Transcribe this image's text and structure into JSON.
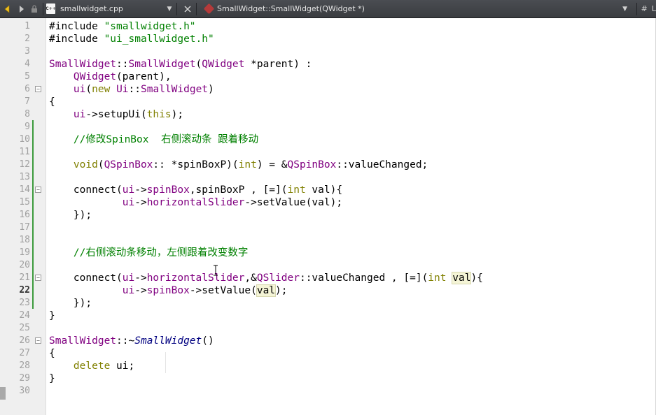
{
  "toolbar": {
    "file_name": "smallwidget.cpp",
    "file_icon_text": "C++",
    "function": "SmallWidget::SmallWidget(QWidget *)",
    "right_label": "L",
    "right_hash": "#"
  },
  "editor": {
    "current_line": 22,
    "lines": [
      {
        "n": "1",
        "tokens": [
          {
            "t": "#include ",
            "c": "p"
          },
          {
            "t": "\"smallwidget.h\"",
            "c": "s"
          }
        ]
      },
      {
        "n": "2",
        "tokens": [
          {
            "t": "#include ",
            "c": "p"
          },
          {
            "t": "\"ui_smallwidget.h\"",
            "c": "s"
          }
        ]
      },
      {
        "n": "3",
        "tokens": []
      },
      {
        "n": "4",
        "tokens": [
          {
            "t": "SmallWidget",
            "c": "t"
          },
          {
            "t": "::",
            "c": "o"
          },
          {
            "t": "SmallWidget",
            "c": "t"
          },
          {
            "t": "(",
            "c": "o"
          },
          {
            "t": "QWidget",
            "c": "t"
          },
          {
            "t": " *parent) :",
            "c": "o"
          }
        ]
      },
      {
        "n": "5",
        "tokens": [
          {
            "t": "    ",
            "c": "o"
          },
          {
            "t": "QWidget",
            "c": "t"
          },
          {
            "t": "(parent),",
            "c": "o"
          }
        ]
      },
      {
        "n": "6",
        "fold": true,
        "tokens": [
          {
            "t": "    ",
            "c": "o"
          },
          {
            "t": "ui",
            "c": "t"
          },
          {
            "t": "(",
            "c": "o"
          },
          {
            "t": "new",
            "c": "k"
          },
          {
            "t": " ",
            "c": "o"
          },
          {
            "t": "Ui",
            "c": "t"
          },
          {
            "t": "::",
            "c": "o"
          },
          {
            "t": "SmallWidget",
            "c": "t"
          },
          {
            "t": ")",
            "c": "o"
          }
        ]
      },
      {
        "n": "7",
        "tokens": [
          {
            "t": "{",
            "c": "o"
          }
        ]
      },
      {
        "n": "8",
        "tokens": [
          {
            "t": "    ",
            "c": "o"
          },
          {
            "t": "ui",
            "c": "t"
          },
          {
            "t": "->",
            "c": "o"
          },
          {
            "t": "setupUi",
            "c": "o"
          },
          {
            "t": "(",
            "c": "o"
          },
          {
            "t": "this",
            "c": "k"
          },
          {
            "t": ");",
            "c": "o"
          }
        ]
      },
      {
        "n": "9",
        "tokens": []
      },
      {
        "n": "10",
        "tokens": [
          {
            "t": "    ",
            "c": "o"
          },
          {
            "t": "//修改SpinBox  右侧滚动条 跟着移动",
            "c": "c"
          }
        ]
      },
      {
        "n": "11",
        "tokens": []
      },
      {
        "n": "12",
        "tokens": [
          {
            "t": "    ",
            "c": "o"
          },
          {
            "t": "void",
            "c": "k"
          },
          {
            "t": "(",
            "c": "o"
          },
          {
            "t": "QSpinBox",
            "c": "t"
          },
          {
            "t": ":: *spinBoxP)(",
            "c": "o"
          },
          {
            "t": "int",
            "c": "k"
          },
          {
            "t": ") = &",
            "c": "o"
          },
          {
            "t": "QSpinBox",
            "c": "t"
          },
          {
            "t": "::valueChanged;",
            "c": "o"
          }
        ]
      },
      {
        "n": "13",
        "tokens": []
      },
      {
        "n": "14",
        "fold": true,
        "tokens": [
          {
            "t": "    connect(",
            "c": "o"
          },
          {
            "t": "ui",
            "c": "t"
          },
          {
            "t": "->",
            "c": "o"
          },
          {
            "t": "spinBox",
            "c": "t"
          },
          {
            "t": ",spinBoxP , [=](",
            "c": "o"
          },
          {
            "t": "int",
            "c": "k"
          },
          {
            "t": " val){",
            "c": "o"
          }
        ]
      },
      {
        "n": "15",
        "tokens": [
          {
            "t": "            ",
            "c": "o"
          },
          {
            "t": "ui",
            "c": "t"
          },
          {
            "t": "->",
            "c": "o"
          },
          {
            "t": "horizontalSlider",
            "c": "t"
          },
          {
            "t": "->setValue(val);",
            "c": "o"
          }
        ]
      },
      {
        "n": "16",
        "tokens": [
          {
            "t": "    });",
            "c": "o"
          }
        ]
      },
      {
        "n": "17",
        "tokens": []
      },
      {
        "n": "18",
        "tokens": []
      },
      {
        "n": "19",
        "tokens": [
          {
            "t": "    ",
            "c": "o"
          },
          {
            "t": "//右侧滚动条移动，左侧跟着改变数字",
            "c": "c"
          }
        ]
      },
      {
        "n": "20",
        "tokens": []
      },
      {
        "n": "21",
        "fold": true,
        "tokens": [
          {
            "t": "    connect(",
            "c": "o"
          },
          {
            "t": "ui",
            "c": "t"
          },
          {
            "t": "->",
            "c": "o"
          },
          {
            "t": "horizontalSlider",
            "c": "t"
          },
          {
            "t": ",&",
            "c": "o"
          },
          {
            "t": "QSlider",
            "c": "t"
          },
          {
            "t": "::valueChanged , [=](",
            "c": "o"
          },
          {
            "t": "int",
            "c": "k"
          },
          {
            "t": " ",
            "c": "o"
          },
          {
            "t": "val",
            "c": "hl"
          },
          {
            "t": "){",
            "c": "o"
          }
        ]
      },
      {
        "n": "22",
        "tokens": [
          {
            "t": "            ",
            "c": "o"
          },
          {
            "t": "ui",
            "c": "t"
          },
          {
            "t": "->",
            "c": "o"
          },
          {
            "t": "spinBox",
            "c": "t"
          },
          {
            "t": "->setValue(",
            "c": "o"
          },
          {
            "t": "val",
            "c": "hl"
          },
          {
            "t": ");",
            "c": "o"
          }
        ]
      },
      {
        "n": "23",
        "tokens": [
          {
            "t": "    });",
            "c": "o"
          }
        ]
      },
      {
        "n": "24",
        "tokens": [
          {
            "t": "}",
            "c": "o"
          }
        ]
      },
      {
        "n": "25",
        "tokens": []
      },
      {
        "n": "26",
        "fold": true,
        "tokens": [
          {
            "t": "SmallWidget",
            "c": "t"
          },
          {
            "t": "::~",
            "c": "o"
          },
          {
            "t": "SmallWidget",
            "c": "i"
          },
          {
            "t": "()",
            "c": "o"
          }
        ]
      },
      {
        "n": "27",
        "tokens": [
          {
            "t": "{",
            "c": "o"
          }
        ]
      },
      {
        "n": "28",
        "tokens": [
          {
            "t": "    ",
            "c": "o"
          },
          {
            "t": "delete",
            "c": "k"
          },
          {
            "t": " ui;",
            "c": "o"
          }
        ]
      },
      {
        "n": "29",
        "tokens": [
          {
            "t": "}",
            "c": "o"
          }
        ]
      },
      {
        "n": "30",
        "tokens": []
      }
    ]
  },
  "colors": {
    "keyword": "#808000",
    "type": "#800080",
    "string": "#008000",
    "comment": "#008000",
    "change_marker": "#3c9a3c"
  }
}
